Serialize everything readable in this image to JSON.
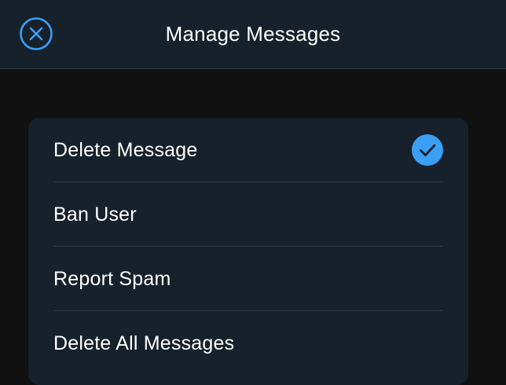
{
  "header": {
    "title": "Manage Messages",
    "close_icon": "close-circle-icon"
  },
  "options": [
    {
      "label": "Delete Message",
      "selected": true
    },
    {
      "label": "Ban User",
      "selected": false
    },
    {
      "label": "Report Spam",
      "selected": false
    },
    {
      "label": "Delete All Messages",
      "selected": false
    }
  ],
  "colors": {
    "accent": "#3a9ff5",
    "header_bg": "#17212b",
    "page_bg": "#111111",
    "card_bg": "#17212b",
    "text": "#ffffff"
  },
  "icons": {
    "selected": "checkmark-circle-icon"
  }
}
